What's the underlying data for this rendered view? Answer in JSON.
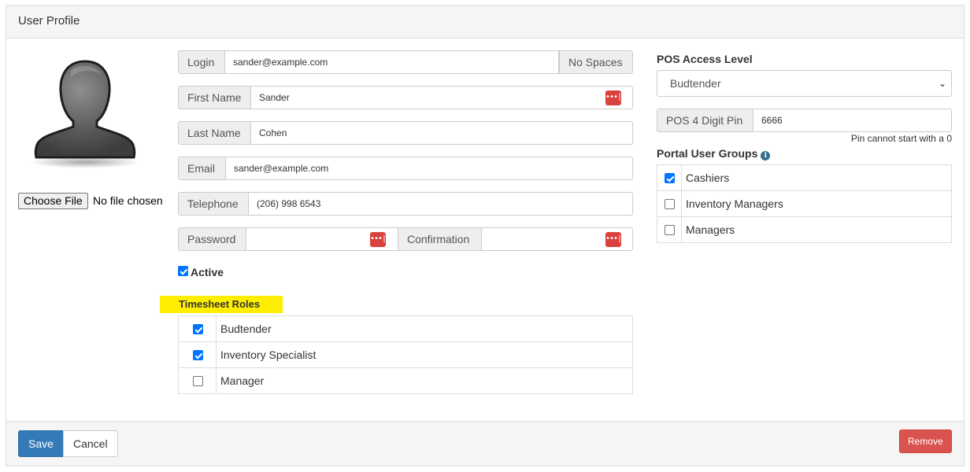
{
  "panel": {
    "title": "User Profile"
  },
  "avatar": {
    "icon": "user-silhouette-icon"
  },
  "file": {
    "button_label": "Choose File",
    "status": "No file chosen"
  },
  "form": {
    "login": {
      "label": "Login",
      "value": "sander@example.com",
      "suffix": "No Spaces"
    },
    "first_name": {
      "label": "First Name",
      "value": "Sander"
    },
    "last_name": {
      "label": "Last Name",
      "value": "Cohen"
    },
    "email": {
      "label": "Email",
      "value": "sander@example.com"
    },
    "telephone": {
      "label": "Telephone",
      "value": "(206) 998 6543"
    },
    "password": {
      "label": "Password",
      "value": ""
    },
    "confirmation": {
      "label": "Confirmation",
      "value": ""
    },
    "active": {
      "label": "Active",
      "checked": true
    },
    "password_manager_icon": "•••|"
  },
  "timesheet_roles": {
    "title": "Timesheet Roles",
    "items": [
      {
        "label": "Budtender",
        "checked": true
      },
      {
        "label": "Inventory Specialist",
        "checked": true
      },
      {
        "label": "Manager",
        "checked": false
      }
    ]
  },
  "pos": {
    "access_level_label": "POS Access Level",
    "access_level_value": "Budtender",
    "pin_label": "POS 4 Digit Pin",
    "pin_value": "6666",
    "pin_help": "Pin cannot start with a 0"
  },
  "portal_groups": {
    "title": "Portal User Groups",
    "info_icon": "i",
    "items": [
      {
        "label": "Cashiers",
        "checked": true
      },
      {
        "label": "Inventory Managers",
        "checked": false
      },
      {
        "label": "Managers",
        "checked": false
      }
    ]
  },
  "footer": {
    "save": "Save",
    "cancel": "Cancel",
    "remove": "Remove"
  },
  "colors": {
    "primary": "#337ab7",
    "danger": "#d9534f",
    "highlight": "#ffee00",
    "checkbox": "#0075ff"
  }
}
